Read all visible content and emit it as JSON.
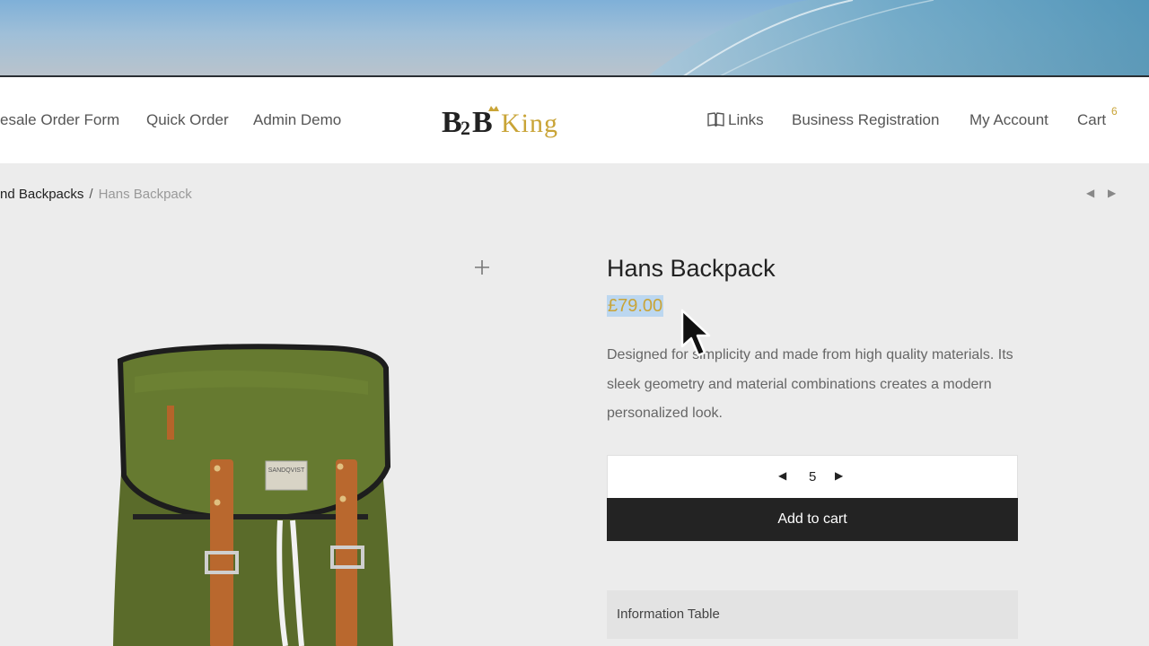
{
  "header": {
    "nav_left": [
      "esale Order Form",
      "Quick Order",
      "Admin Demo"
    ],
    "logo_text": {
      "part1": "B",
      "part2": "2",
      "part3": "B",
      "part4": "King"
    },
    "nav_right": {
      "links": "Links",
      "business_registration": "Business Registration",
      "my_account": "My Account",
      "cart": "Cart",
      "cart_count": "6"
    }
  },
  "breadcrumb": {
    "parent": "nd Backpacks",
    "separator": "/",
    "current": "Hans Backpack"
  },
  "product": {
    "title": "Hans Backpack",
    "price": "£79.00",
    "description": "Designed for simplicity and made from high quality materials. Its sleek geometry and material combinations creates a modern personalized look.",
    "quantity": "5",
    "add_to_cart_label": "Add to cart",
    "info_tab_label": "Information Table",
    "image_label": "SANDQVIST"
  },
  "icons": {
    "links": "book-icon",
    "prev": "prev-arrow-icon",
    "next": "next-arrow-icon",
    "zoom": "plus-icon",
    "cursor": "mouse-pointer-icon"
  },
  "colors": {
    "accent": "#c9a437",
    "button_bg": "#232323",
    "page_bg": "#ececec"
  }
}
